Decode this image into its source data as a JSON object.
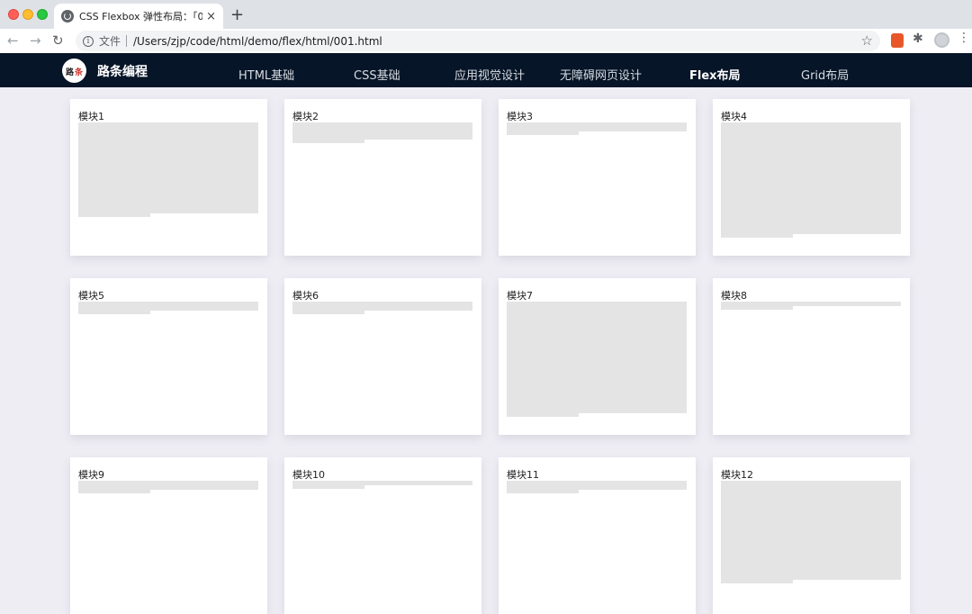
{
  "browser": {
    "tab_title": "CSS Flexbox 弹性布局：「01」",
    "tab_close": "×",
    "new_tab": "+",
    "back": "←",
    "forward": "→",
    "reload": "↻",
    "info": "i",
    "scheme": "文件",
    "url": "/Users/zjp/code/html/demo/flex/html/001.html",
    "star": "☆",
    "puzzle": "✱",
    "menu": "⋮"
  },
  "site": {
    "logo_text_1": "路",
    "logo_text_2": "条",
    "brand": "路条编程",
    "nav": [
      {
        "label": "HTML基础",
        "active": false
      },
      {
        "label": "CSS基础",
        "active": false
      },
      {
        "label": "应用视觉设计",
        "active": false
      },
      {
        "label": "无障碍网页设计",
        "active": false
      },
      {
        "label": "Flex布局",
        "active": true
      },
      {
        "label": "Grid布局",
        "active": false
      }
    ]
  },
  "cards": [
    {
      "title": "模块1"
    },
    {
      "title": "模块2"
    },
    {
      "title": "模块3"
    },
    {
      "title": "模块4"
    },
    {
      "title": "模块5"
    },
    {
      "title": "模块6"
    },
    {
      "title": "模块7"
    },
    {
      "title": "模块8"
    },
    {
      "title": "模块9"
    },
    {
      "title": "模块10"
    },
    {
      "title": "模块11"
    },
    {
      "title": "模块12"
    }
  ],
  "colors": {
    "nav_bg": "#061527",
    "page_bg": "#efedf4",
    "placeholder": "#e4e4e4"
  }
}
